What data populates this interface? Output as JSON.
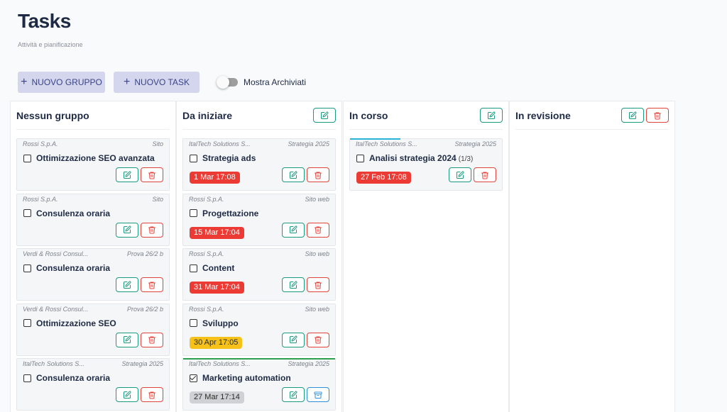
{
  "header": {
    "title": "Tasks",
    "subtitle": "Attività e pianificazione"
  },
  "toolbar": {
    "new_group": "NUOVO GRUPPO",
    "new_task": "NUOVO TASK",
    "archived_label": "Mostra Archiviati",
    "archived_on": false
  },
  "colors": {
    "accent_edit": "#1a9a80",
    "accent_delete": "#e0453c",
    "accent_archive": "#2f8fd6",
    "due_overdue": "#ec3a34",
    "due_soon": "#f6c21a",
    "due_done": "#cfd1d4"
  },
  "columns": [
    {
      "title": "Nessun gruppo",
      "cards": [
        {
          "client": "Rossi S.p.A.",
          "group": "Sito",
          "task": "Ottimizzazione SEO avanzata"
        },
        {
          "client": "Rossi S.p.A.",
          "group": "Sito",
          "task": "Consulenza oraria"
        },
        {
          "client": "Verdi & Rossi Consul...",
          "group": "Prova 26/2 b",
          "task": "Consulenza oraria"
        },
        {
          "client": "Verdi & Rossi Consul...",
          "group": "Prova 26/2 b",
          "task": "Ottimizzazione SEO"
        },
        {
          "client": "ItalTech Solutions S...",
          "group": "Strategia 2025",
          "task": "Consulenza oraria"
        }
      ]
    },
    {
      "title": "Da iniziare",
      "cards": [
        {
          "client": "ItalTech Solutions S...",
          "group": "Strategia 2025",
          "task": "Strategia ads",
          "due": "1 Mar 17:08"
        },
        {
          "client": "Rossi S.p.A.",
          "group": "Sito web",
          "task": "Progettazione",
          "due": "15 Mar 17:04"
        },
        {
          "client": "Rossi S.p.A.",
          "group": "Sito web",
          "task": "Content",
          "due": "31 Mar 17:04"
        },
        {
          "client": "Rossi S.p.A.",
          "group": "Sito web",
          "task": "Sviluppo",
          "due": "30 Apr 17:05"
        },
        {
          "client": "ItalTech Solutions S...",
          "group": "Strategia 2025",
          "task": "Marketing automation",
          "due": "27 Mar 17:14",
          "checked": true
        }
      ]
    },
    {
      "title": "In corso",
      "cards": [
        {
          "client": "ItalTech Solutions S...",
          "group": "Strategia 2025",
          "task": "Analisi strategia 2024",
          "subtasks": "(1/3)",
          "due": "27 Feb 17:08",
          "progress": 0.33
        }
      ]
    },
    {
      "title": "In revisione",
      "cards": []
    }
  ]
}
